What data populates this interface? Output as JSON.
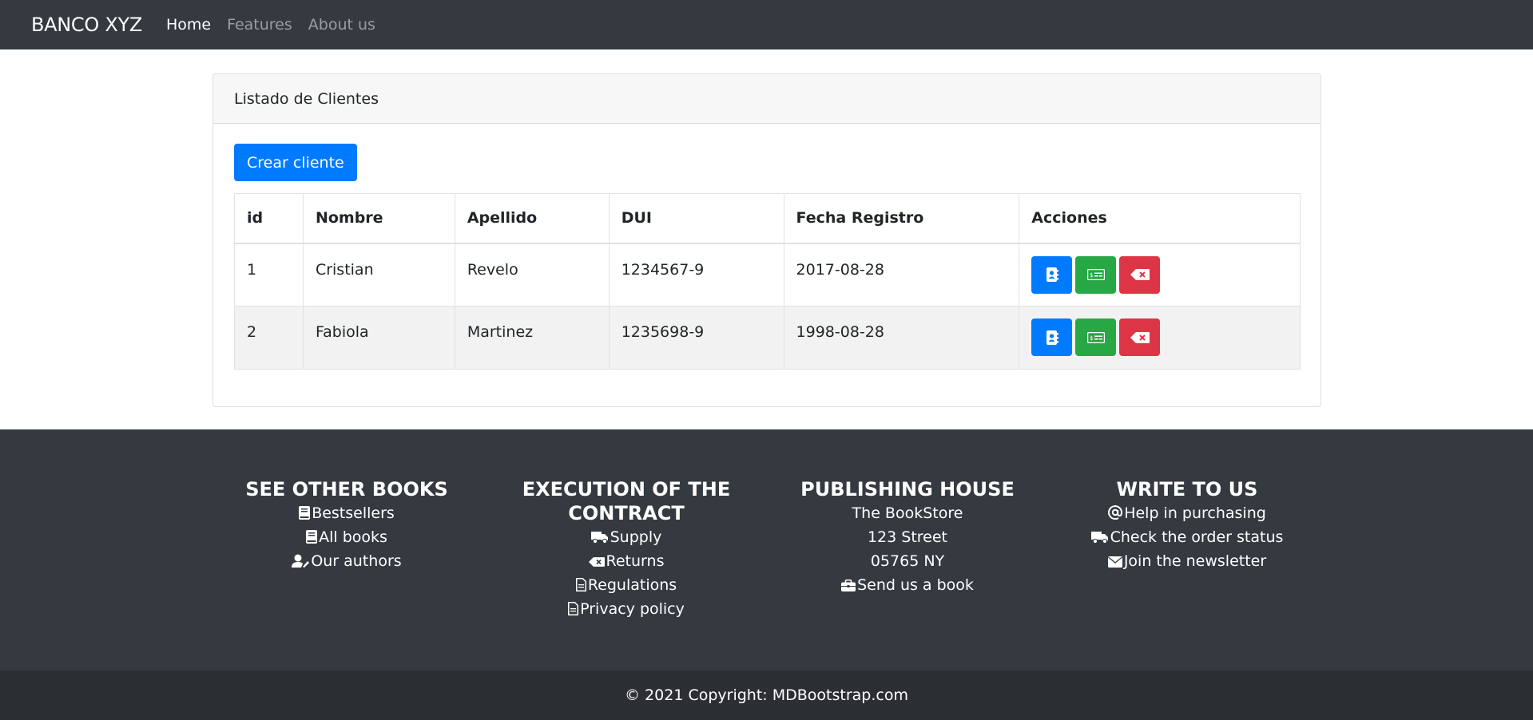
{
  "navbar": {
    "brand": "BANCO XYZ",
    "links": [
      {
        "label": "Home",
        "active": true
      },
      {
        "label": "Features",
        "active": false
      },
      {
        "label": "About us",
        "active": false
      }
    ]
  },
  "card": {
    "header": "Listado de Clientes",
    "create_button": "Crear cliente",
    "columns": [
      "id",
      "Nombre",
      "Apellido",
      "DUI",
      "Fecha Registro",
      "Acciones"
    ],
    "rows": [
      {
        "id": "1",
        "nombre": "Cristian",
        "apellido": "Revelo",
        "dui": "1234567-9",
        "fecha": "2017-08-28"
      },
      {
        "id": "2",
        "nombre": "Fabiola",
        "apellido": "Martinez",
        "dui": "1235698-9",
        "fecha": "1998-08-28"
      }
    ],
    "action_icons": [
      "contact-book-icon",
      "money-check-icon",
      "backspace-icon"
    ]
  },
  "footer": {
    "columns": [
      {
        "title": "SEE OTHER BOOKS",
        "items": [
          {
            "icon": "book-icon",
            "label": "Bestsellers"
          },
          {
            "icon": "book-icon",
            "label": "All books"
          },
          {
            "icon": "user-edit-icon",
            "label": "Our authors"
          }
        ]
      },
      {
        "title": "EXECUTION OF THE CONTRACT",
        "items": [
          {
            "icon": "truck-icon",
            "label": "Supply"
          },
          {
            "icon": "backspace-icon",
            "label": "Returns"
          },
          {
            "icon": "file-icon",
            "label": "Regulations"
          },
          {
            "icon": "file-icon",
            "label": "Privacy policy"
          }
        ]
      },
      {
        "title": "PUBLISHING HOUSE",
        "items": [
          {
            "icon": "",
            "label": "The BookStore"
          },
          {
            "icon": "",
            "label": "123 Street"
          },
          {
            "icon": "",
            "label": "05765 NY"
          },
          {
            "icon": "briefcase-icon",
            "label": "Send us a book"
          }
        ]
      },
      {
        "title": "WRITE TO US",
        "items": [
          {
            "icon": "at-icon",
            "label": "Help in purchasing"
          },
          {
            "icon": "truck-icon",
            "label": "Check the order status"
          },
          {
            "icon": "envelope-icon",
            "label": "Join the newsletter"
          }
        ]
      }
    ],
    "copyright": "© 2021 Copyright: MDBootstrap.com"
  },
  "colors": {
    "primary": "#007bff",
    "success": "#28a745",
    "danger": "#dc3545",
    "dark": "#343a40"
  }
}
